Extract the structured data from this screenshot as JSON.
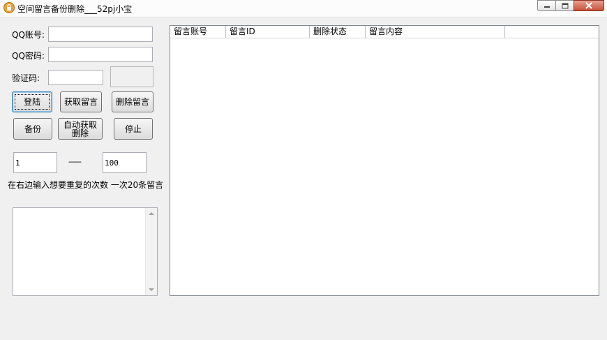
{
  "window": {
    "title": "空间留言备份删除___52pj小宝"
  },
  "form": {
    "qq_account_label": "QQ账号:",
    "qq_account_value": "",
    "qq_password_label": "QQ密码:",
    "qq_password_value": "",
    "captcha_label": "验证码:",
    "captcha_value": ""
  },
  "buttons": {
    "login": "登陆",
    "fetch_messages": "获取留言",
    "delete_messages": "删除留言",
    "backup": "备份",
    "auto_fetch_delete": "自动获取\n删除",
    "stop": "停止"
  },
  "range": {
    "start": "1",
    "separator": "------",
    "end": "100",
    "hint": "在右边输入想要重复的次数  一次20条留言"
  },
  "log": {
    "content": ""
  },
  "table": {
    "columns": [
      "留言账号",
      "留言ID",
      "删除状态",
      "留言内容"
    ],
    "rows": []
  }
}
